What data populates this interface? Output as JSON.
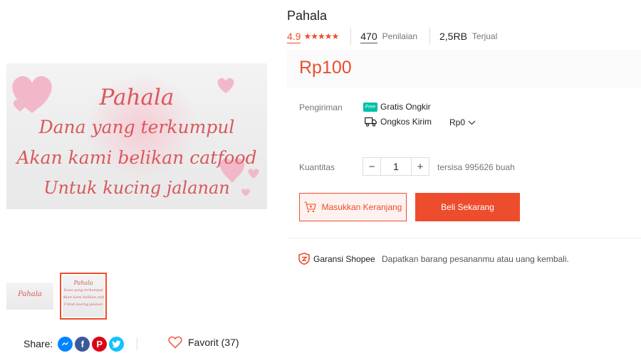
{
  "gallery": {
    "banner_lines": [
      "Pahala",
      "Dana yang terkumpul",
      "Akan kami belikan catfood",
      "Untuk kucing jalanan"
    ],
    "thumb_title": "Pahala"
  },
  "share": {
    "label": "Share:"
  },
  "favorite": {
    "label": "Favorit (37)"
  },
  "product": {
    "title": "Pahala",
    "rating": "4.9",
    "stars": "★★★★★",
    "reviews_count": "470",
    "reviews_label": "Penilaian",
    "sold_count": "2,5RB",
    "sold_label": "Terjual",
    "price": "Rp100"
  },
  "shipping": {
    "label": "Pengiriman",
    "free_badge": "Free",
    "free_label": "Gratis Ongkir",
    "cost_label": "Ongkos Kirim",
    "cost_value": "Rp0"
  },
  "quantity": {
    "label": "Kuantitas",
    "minus": "−",
    "value": "1",
    "plus": "+",
    "stock": "tersisa 995626 buah"
  },
  "actions": {
    "cart_label": "Masukkan Keranjang",
    "buy_label": "Beli Sekarang"
  },
  "guarantee": {
    "label": "Garansi Shopee",
    "desc": "Dapatkan barang pesananmu atau uang kembali."
  },
  "colors": {
    "accent": "#ee4d2d",
    "heart": "#f2b8c9"
  }
}
